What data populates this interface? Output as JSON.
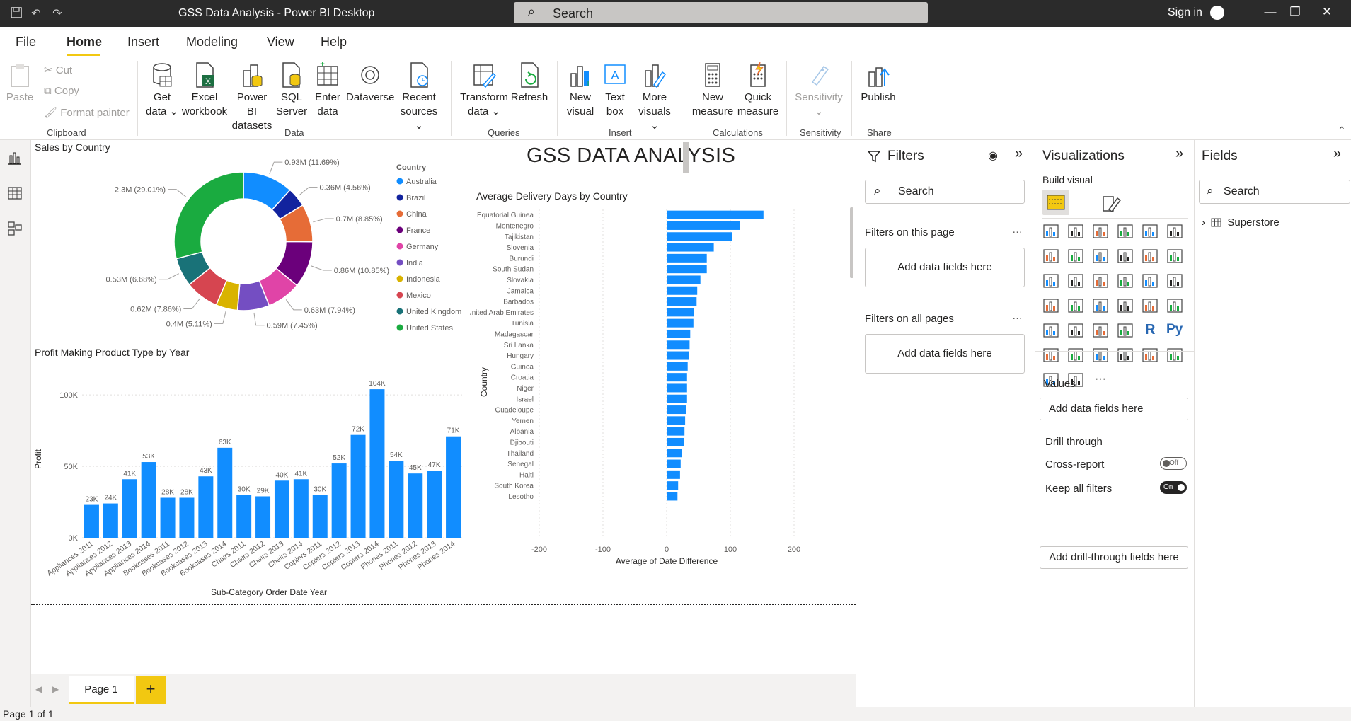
{
  "titlebar": {
    "title": "GSS Data Analysis - Power BI Desktop",
    "search": "Search",
    "signin": "Sign in"
  },
  "menu": {
    "tabs": [
      "File",
      "Home",
      "Insert",
      "Modeling",
      "View",
      "Help"
    ],
    "active": "Home"
  },
  "ribbon": {
    "clipboard": {
      "paste": "Paste",
      "cut": "Cut",
      "copy": "Copy",
      "format_painter": "Format painter",
      "label": "Clipboard"
    },
    "data": {
      "label": "Data",
      "buttons": [
        {
          "l1": "Get",
          "l2": "data ⌄"
        },
        {
          "l1": "Excel",
          "l2": "workbook"
        },
        {
          "l1": "Power BI",
          "l2": "datasets"
        },
        {
          "l1": "SQL",
          "l2": "Server"
        },
        {
          "l1": "Enter",
          "l2": "data"
        },
        {
          "l1": "Dataverse",
          "l2": ""
        },
        {
          "l1": "Recent",
          "l2": "sources ⌄"
        }
      ]
    },
    "queries": {
      "label": "Queries",
      "transform_1": "Transform",
      "transform_2": "data ⌄",
      "refresh": "Refresh"
    },
    "insert": {
      "label": "Insert",
      "new_visual_1": "New",
      "new_visual_2": "visual",
      "text_box_1": "Text",
      "text_box_2": "box",
      "more_visuals_1": "More",
      "more_visuals_2": "visuals ⌄"
    },
    "calculations": {
      "label": "Calculations",
      "new_measure_1": "New",
      "new_measure_2": "measure",
      "quick_measure_1": "Quick",
      "quick_measure_2": "measure"
    },
    "sensitivity": {
      "label": "Sensitivity",
      "button": "Sensitivity",
      "arrow": "⌄"
    },
    "share": {
      "label": "Share",
      "publish": "Publish"
    }
  },
  "report": {
    "title": "GSS DATA ANALYSIS",
    "donut": {
      "title": "Sales by Country",
      "legend_title": "Country",
      "labels": [
        "0.93M (11.69%)",
        "0.36M (4.56%)",
        "0.7M (8.85%)",
        "0.86M (10.85%)",
        "0.63M (7.94%)",
        "0.59M (7.45%)",
        "0.4M (5.11%)",
        "0.62M (7.86%)",
        "0.53M (6.68%)",
        "2.3M (29.01%)"
      ]
    },
    "bar": {
      "title": "Profit Making Product Type by Year"
    },
    "hbar": {
      "title": "Average Delivery Days by Country"
    }
  },
  "chart_data": [
    {
      "type": "pie",
      "title": "Sales by Country",
      "legend_title": "Country",
      "categories": [
        "Australia",
        "Brazil",
        "China",
        "France",
        "Germany",
        "India",
        "Indonesia",
        "Mexico",
        "United Kingdom",
        "United States"
      ],
      "values": [
        0.93,
        0.36,
        0.7,
        0.86,
        0.63,
        0.59,
        0.4,
        0.62,
        0.53,
        2.3
      ],
      "percents": [
        11.69,
        4.56,
        8.85,
        10.85,
        7.94,
        7.45,
        5.11,
        7.86,
        6.68,
        29.01
      ],
      "colors": [
        "#118dff",
        "#12239e",
        "#e66c37",
        "#6b007b",
        "#e044a7",
        "#744ec2",
        "#d9b300",
        "#d64550",
        "#197278",
        "#1aab40"
      ]
    },
    {
      "type": "bar",
      "title": "Profit Making Product Type by Year",
      "xlabel": "Sub-Category Order Date Year",
      "ylabel": "Profit",
      "yticks": [
        "0K",
        "50K",
        "100K"
      ],
      "ylim": [
        0,
        110
      ],
      "categories": [
        "Appliances 2011",
        "Appliances 2012",
        "Appliances 2013",
        "Appliances 2014",
        "Bookcases 2011",
        "Bookcases 2012",
        "Bookcases 2013",
        "Bookcases 2014",
        "Chairs 2011",
        "Chairs 2012",
        "Chairs 2013",
        "Chairs 2014",
        "Copiers 2011",
        "Copiers 2012",
        "Copiers 2013",
        "Copiers 2014",
        "Phones 2011",
        "Phones 2012",
        "Phones 2013",
        "Phones 2014"
      ],
      "values": [
        23,
        24,
        41,
        53,
        28,
        28,
        43,
        63,
        30,
        29,
        40,
        41,
        30,
        52,
        72,
        104,
        54,
        45,
        47,
        71
      ],
      "data_labels": [
        "23K",
        "24K",
        "41K",
        "53K",
        "28K",
        "28K",
        "43K",
        "63K",
        "30K",
        "29K",
        "40K",
        "41K",
        "30K",
        "52K",
        "72K",
        "104K",
        "54K",
        "45K",
        "47K",
        "71K"
      ],
      "color": "#118dff"
    },
    {
      "type": "bar",
      "orientation": "horizontal",
      "title": "Average Delivery Days by Country",
      "xlabel": "Average of Date Difference",
      "ylabel": "Country",
      "xlim": [
        -200,
        200
      ],
      "xticks": [
        "-200",
        "-100",
        "0",
        "100",
        "200"
      ],
      "categories": [
        "Equatorial Guinea",
        "Montenegro",
        "Tajikistan",
        "Slovenia",
        "Burundi",
        "South Sudan",
        "Slovakia",
        "Jamaica",
        "Barbados",
        "United Arab Emirates",
        "Tunisia",
        "Madagascar",
        "Sri Lanka",
        "Hungary",
        "Guinea",
        "Croatia",
        "Niger",
        "Israel",
        "Guadeloupe",
        "Yemen",
        "Albania",
        "Djibouti",
        "Thailand",
        "Senegal",
        "Haiti",
        "South Korea",
        "Lesotho"
      ],
      "values": [
        152,
        115,
        103,
        74,
        63,
        63,
        53,
        48,
        47,
        43,
        42,
        37,
        36,
        35,
        33,
        32,
        32,
        32,
        31,
        29,
        28,
        27,
        24,
        22,
        21,
        18,
        17
      ],
      "color": "#118dff"
    }
  ],
  "filters": {
    "title": "Filters",
    "search": "Search",
    "this_page": "Filters on this page",
    "all_pages": "Filters on all pages",
    "add": "Add data fields here",
    "more": "…"
  },
  "visualizations": {
    "title": "Visualizations",
    "build": "Build visual",
    "values": "Values",
    "values_add": "Add data fields here",
    "drill": "Drill through",
    "cross": "Cross-report",
    "cross_state": "Off",
    "keep": "Keep all filters",
    "keep_state": "On",
    "drill_add": "Add drill-through fields here",
    "r": "R",
    "py": "Py",
    "more": "···"
  },
  "fields": {
    "title": "Fields",
    "search": "Search",
    "table": "Superstore"
  },
  "pages": {
    "tab": "Page 1",
    "add": "+"
  },
  "status": {
    "text": "Page 1 of 1"
  }
}
